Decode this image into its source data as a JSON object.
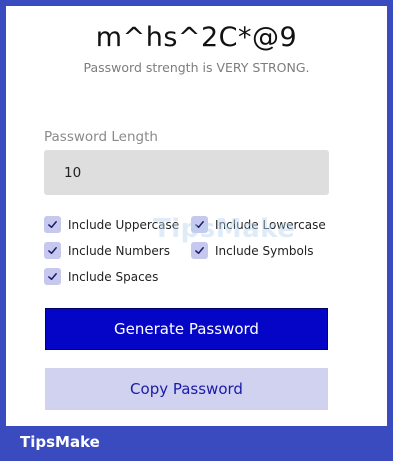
{
  "password": {
    "value": "m^hs^2C*@9",
    "strength_text": "Password strength is VERY STRONG."
  },
  "length": {
    "label": "Password Length",
    "value": "10"
  },
  "options": [
    {
      "label": "Include Uppercase",
      "checked": true
    },
    {
      "label": "Include Lowercase",
      "checked": true
    },
    {
      "label": "Include Numbers",
      "checked": true
    },
    {
      "label": "Include Symbols",
      "checked": true
    },
    {
      "label": "Include Spaces",
      "checked": true
    }
  ],
  "buttons": {
    "generate_label": "Generate Password",
    "copy_label": "Copy Password"
  },
  "watermark": {
    "text": "TipsMake"
  },
  "brand": {
    "name": "TipsMake"
  },
  "colors": {
    "background": "#3a4bc0",
    "generate_button": "#0505c8",
    "copy_button": "#d0d2f0",
    "checkbox": "#c6c8ee"
  }
}
